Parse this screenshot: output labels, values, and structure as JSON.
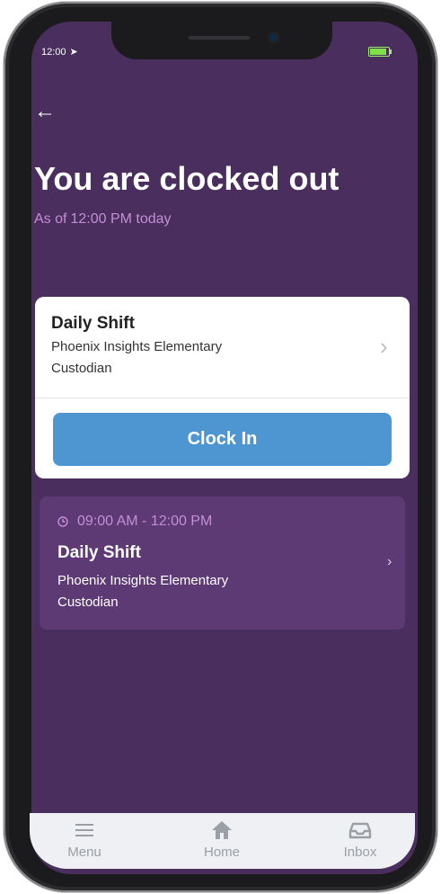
{
  "status_bar": {
    "time": "12:00",
    "location_glyph": "➤"
  },
  "header": {
    "back_icon": "←",
    "title": "You are clocked out",
    "as_of_label": "As of",
    "as_of_time": "12:00 PM today"
  },
  "current_shift": {
    "name": "Daily Shift",
    "location": "Phoenix Insights Elementary",
    "role": "Custodian",
    "chevron": "›",
    "clock_in_label": "Clock In"
  },
  "past_shift": {
    "time_range": "09:00 AM - 12:00 PM",
    "name": "Daily Shift",
    "location": "Phoenix Insights Elementary",
    "role": "Custodian",
    "chevron": "›"
  },
  "tabs": [
    {
      "label": "Menu",
      "icon": "menu-icon"
    },
    {
      "label": "Home",
      "icon": "home-icon"
    },
    {
      "label": "Inbox",
      "icon": "inbox-icon"
    }
  ],
  "colors": {
    "background": "#4a2e5e",
    "accent_text": "#c48ed7",
    "button": "#4d96d1",
    "past_card": "#5e3a74"
  }
}
